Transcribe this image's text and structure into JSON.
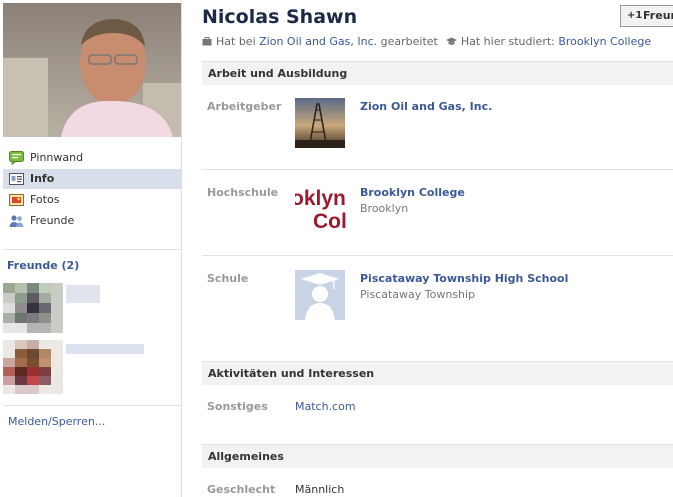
{
  "profile": {
    "name": "Nicolas Shawn",
    "add_friend_plus": "+1",
    "add_friend_label": "Freunde",
    "work_prefix": "Hat bei",
    "work_company": "Zion Oil and Gas, Inc.",
    "work_suffix": "gearbeitet",
    "study_prefix": "Hat hier studiert:",
    "study_school": "Brooklyn College"
  },
  "nav": [
    {
      "label": "Pinnwand",
      "icon": "wall-icon"
    },
    {
      "label": "Info",
      "icon": "info-icon"
    },
    {
      "label": "Fotos",
      "icon": "photos-icon"
    },
    {
      "label": "Freunde",
      "icon": "friends-icon"
    }
  ],
  "friends": {
    "title": "Freunde (2)"
  },
  "report_link": "Melden/Sperren...",
  "sections": {
    "work_education": {
      "title": "Arbeit und Ausbildung",
      "employer_label": "Arbeitgeber",
      "employer": "Zion Oil and Gas, Inc.",
      "college_label": "Hochschule",
      "college": "Brooklyn College",
      "college_location": "Brooklyn",
      "college_logo_text": [
        "oklyn",
        "Coll"
      ],
      "school_label": "Schule",
      "school": "Piscataway Township High School",
      "school_location": "Piscataway Township"
    },
    "activities": {
      "title": "Aktivitäten und Interessen",
      "other_label": "Sonstiges",
      "other_value": "Match.com"
    },
    "general": {
      "title": "Allgemeines",
      "gender_label": "Geschlecht",
      "gender_value": "Männlich"
    }
  },
  "colors": {
    "link": "#3b5998",
    "name": "#1c2a47",
    "section_bg": "#f2f2f2",
    "nav_active_bg": "#d8dfea",
    "college_logo": "#9a1b2f"
  }
}
